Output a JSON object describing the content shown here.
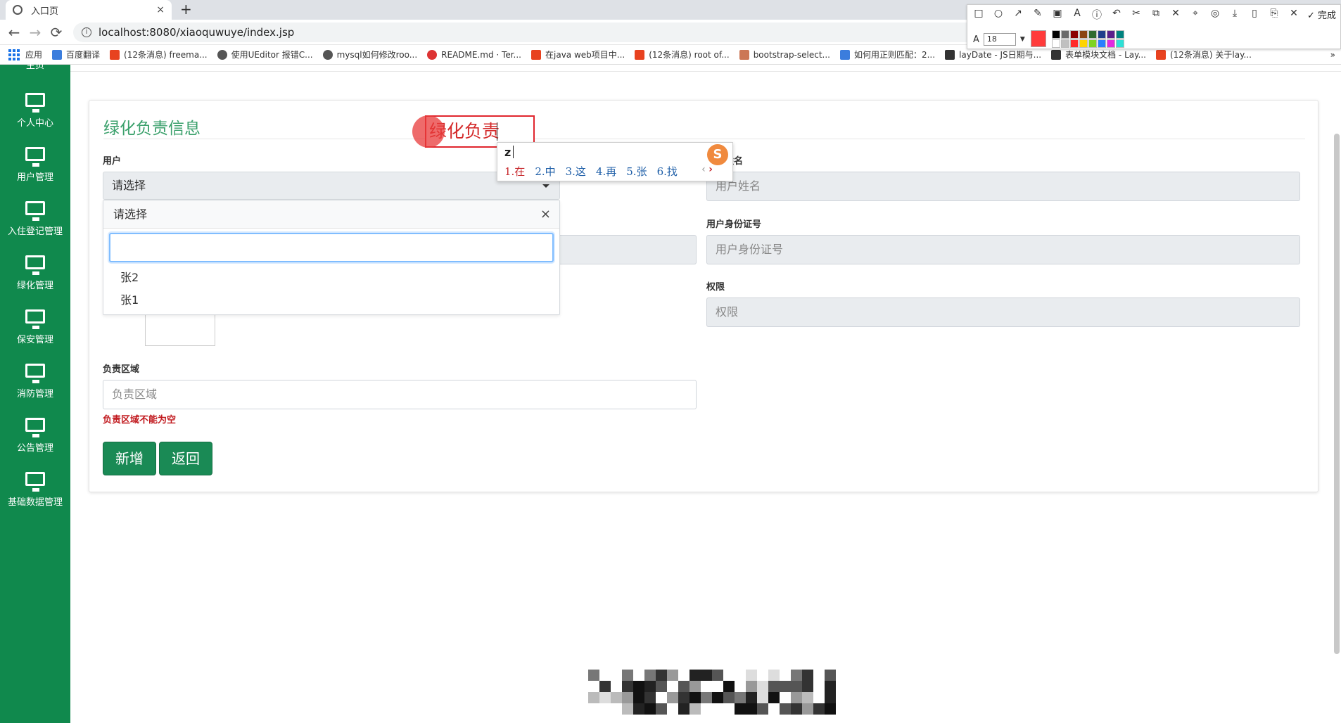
{
  "browser": {
    "tab_title": "入口页",
    "tab_close": "×",
    "new_tab": "+",
    "back": "←",
    "forward": "→",
    "reload": "⟳",
    "url": "localhost:8080/xiaoquwuye/index.jsp",
    "apps_label": "应用",
    "bookmarks": [
      {
        "label": "百度翻译",
        "icon": "baidu-fanyi-icon"
      },
      {
        "label": "(12条消息) freema...",
        "icon": "csdn-icon"
      },
      {
        "label": "使用UEditor 报错C...",
        "icon": "link-icon"
      },
      {
        "label": "mysql如何修改roo...",
        "icon": "link-icon"
      },
      {
        "label": "README.md · Ter...",
        "icon": "gitee-icon"
      },
      {
        "label": "在java web项目中...",
        "icon": "csdn-icon"
      },
      {
        "label": "(12条消息) root of...",
        "icon": "csdn-icon"
      },
      {
        "label": "bootstrap-select...",
        "icon": "site-icon"
      },
      {
        "label": "如何用正则匹配：2...",
        "icon": "baidu-icon"
      },
      {
        "label": "layDate - JS日期与...",
        "icon": "layui-icon"
      },
      {
        "label": "表单模块文档 - Lay...",
        "icon": "layui-icon"
      },
      {
        "label": "(12条消息) 关于lay...",
        "icon": "csdn-icon"
      }
    ],
    "bookmarks_more": "»"
  },
  "screenshot_toolbar": {
    "tools": [
      "□",
      "○",
      "↗",
      "✎",
      "▣",
      "A",
      "ⓘ",
      "↶",
      "✂",
      "⧉",
      "✕",
      "⌖",
      "◎",
      "⤓",
      "▯",
      "⎘",
      "✕"
    ],
    "done_label": "✓ 完成",
    "font_size": "18",
    "current_color": "#ff3b3b",
    "palette": [
      "#000000",
      "#6b6b6b",
      "#8b0000",
      "#8b4513",
      "#2f6b2f",
      "#1f3f8b",
      "#5b1f8b",
      "#00827f",
      "#ffffff",
      "#c0c0c0",
      "#ff2a2a",
      "#ffd400",
      "#7ed321",
      "#2a7fff",
      "#e02be0",
      "#2ee0d6"
    ]
  },
  "sidebar": {
    "partial_label": "主页",
    "items": [
      {
        "label": "个人中心"
      },
      {
        "label": "用户管理"
      },
      {
        "label": "入住登记管理"
      },
      {
        "label": "绿化管理"
      },
      {
        "label": "保安管理"
      },
      {
        "label": "消防管理"
      },
      {
        "label": "公告管理"
      },
      {
        "label": "基础数据管理"
      }
    ]
  },
  "form": {
    "title": "绿化负责信息",
    "user_label": "用户",
    "user_select_value": "请选择",
    "dropdown": {
      "header": "请选择",
      "close": "×",
      "search_value": "",
      "options": [
        "张2",
        "张1"
      ]
    },
    "name_label": "用户姓名",
    "name_placeholder": "用户姓名",
    "id_label": "用户身份证号",
    "id_placeholder": "用户身份证号",
    "role_label": "权限",
    "role_placeholder": "权限",
    "area_label": "负责区域",
    "area_placeholder": "负责区域",
    "area_error": "负责区域不能为空",
    "add_button": "新增",
    "back_button": "返回"
  },
  "ime": {
    "composition_text": "绿化负责",
    "input": "z",
    "logo": "S",
    "candidates": [
      "1.在",
      "2.中",
      "3.这",
      "4.再",
      "5.张",
      "6.找"
    ],
    "prev": "‹",
    "next": "›"
  }
}
